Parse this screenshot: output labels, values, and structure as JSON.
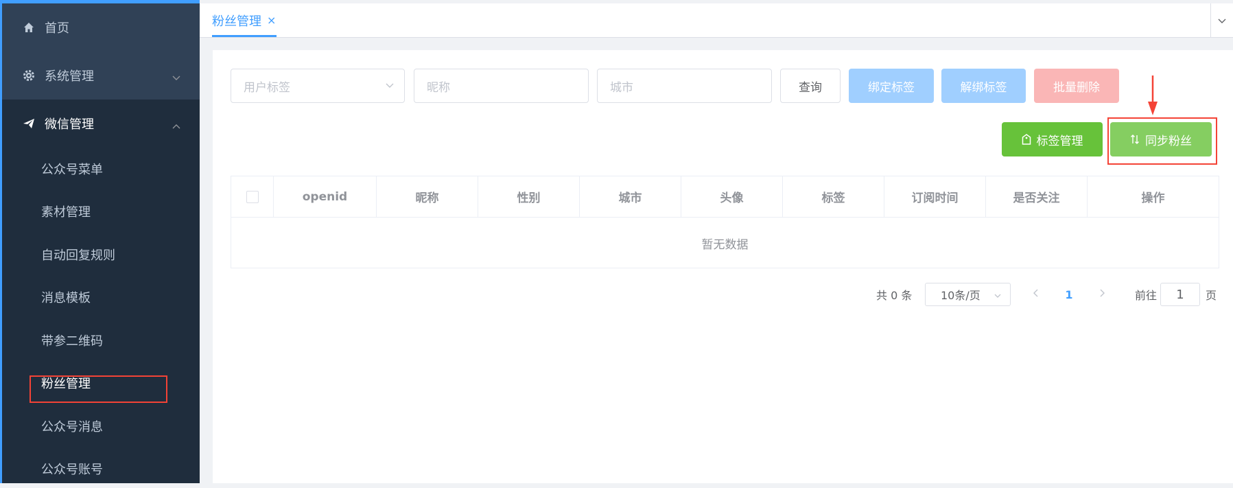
{
  "sidebar": {
    "items": [
      {
        "label": "首页",
        "icon": "home-icon"
      },
      {
        "label": "系统管理",
        "icon": "gear-icon"
      },
      {
        "label": "微信管理",
        "icon": "paper-plane-icon"
      }
    ],
    "sub_items": [
      {
        "label": "公众号菜单"
      },
      {
        "label": "素材管理"
      },
      {
        "label": "自动回复规则"
      },
      {
        "label": "消息模板"
      },
      {
        "label": "带参二维码"
      },
      {
        "label": "粉丝管理"
      },
      {
        "label": "公众号消息"
      },
      {
        "label": "公众号账号"
      }
    ]
  },
  "tabs": {
    "active_label": "粉丝管理",
    "close_glyph": "×"
  },
  "filters": {
    "tag_placeholder": "用户标签",
    "nickname_placeholder": "昵称",
    "city_placeholder": "城市"
  },
  "buttons": {
    "query": "查询",
    "bind_tag": "绑定标签",
    "unbind_tag": "解绑标签",
    "batch_delete": "批量删除",
    "tag_manage": "标签管理",
    "sync_fans": "同步粉丝"
  },
  "table": {
    "columns": [
      "openid",
      "昵称",
      "性别",
      "城市",
      "头像",
      "标签",
      "订阅时间",
      "是否关注",
      "操作"
    ],
    "empty_text": "暂无数据"
  },
  "pagination": {
    "total": "共 0 条",
    "page_size": "10条/页",
    "current_page": "1",
    "goto_label": "前往",
    "goto_value": "1",
    "page_suffix": "页"
  },
  "colors": {
    "sidebar_bg": "#304156",
    "submenu_bg": "#1f2d3d",
    "primary": "#409eff",
    "success": "#67c23a",
    "danger_light": "#fab6b6",
    "annotation_red": "#f44336"
  }
}
